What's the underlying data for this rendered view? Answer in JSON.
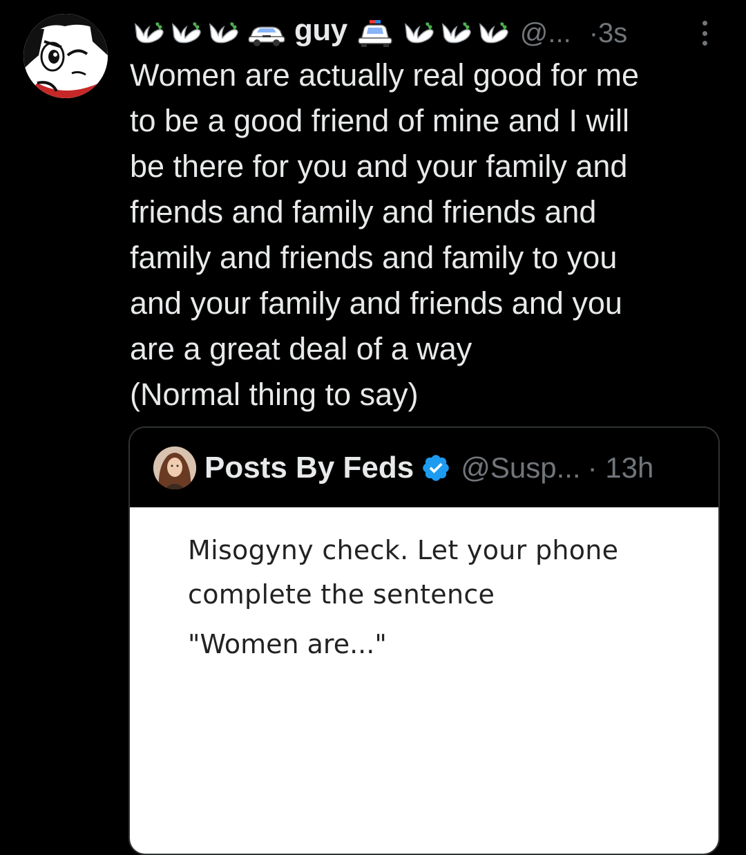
{
  "tweet": {
    "author": {
      "display_name": "guy",
      "handle": "@...",
      "avatar": "cartoon-avatar"
    },
    "separator": "·",
    "time": "3s",
    "text": "Women are actually real good for me\nto be a good friend of mine and I will\nbe there for you and your family and\nfriends and family and friends and\nfamily and friends and family to you\nand your family and friends and you\nare a great deal of a way\n(Normal thing to say)",
    "more_icon": "more-vertical-icon",
    "name_emojis": [
      "dove-icon",
      "police-car-icon"
    ]
  },
  "quote": {
    "author": {
      "display_name": "Posts By Feds",
      "handle": "@Susp...",
      "verified": true,
      "avatar": "profile-photo"
    },
    "separator": "·",
    "time": "13h",
    "media": {
      "line1": "Misogyny check. Let your phone complete the sentence",
      "line2": "\"Women are...\""
    }
  },
  "colors": {
    "background": "#000000",
    "text_primary": "#e7e9ea",
    "text_secondary": "#71767b",
    "border": "#2f3336",
    "verified_blue": "#1d9bf0",
    "media_bg": "#ffffff",
    "media_text": "#222222"
  }
}
